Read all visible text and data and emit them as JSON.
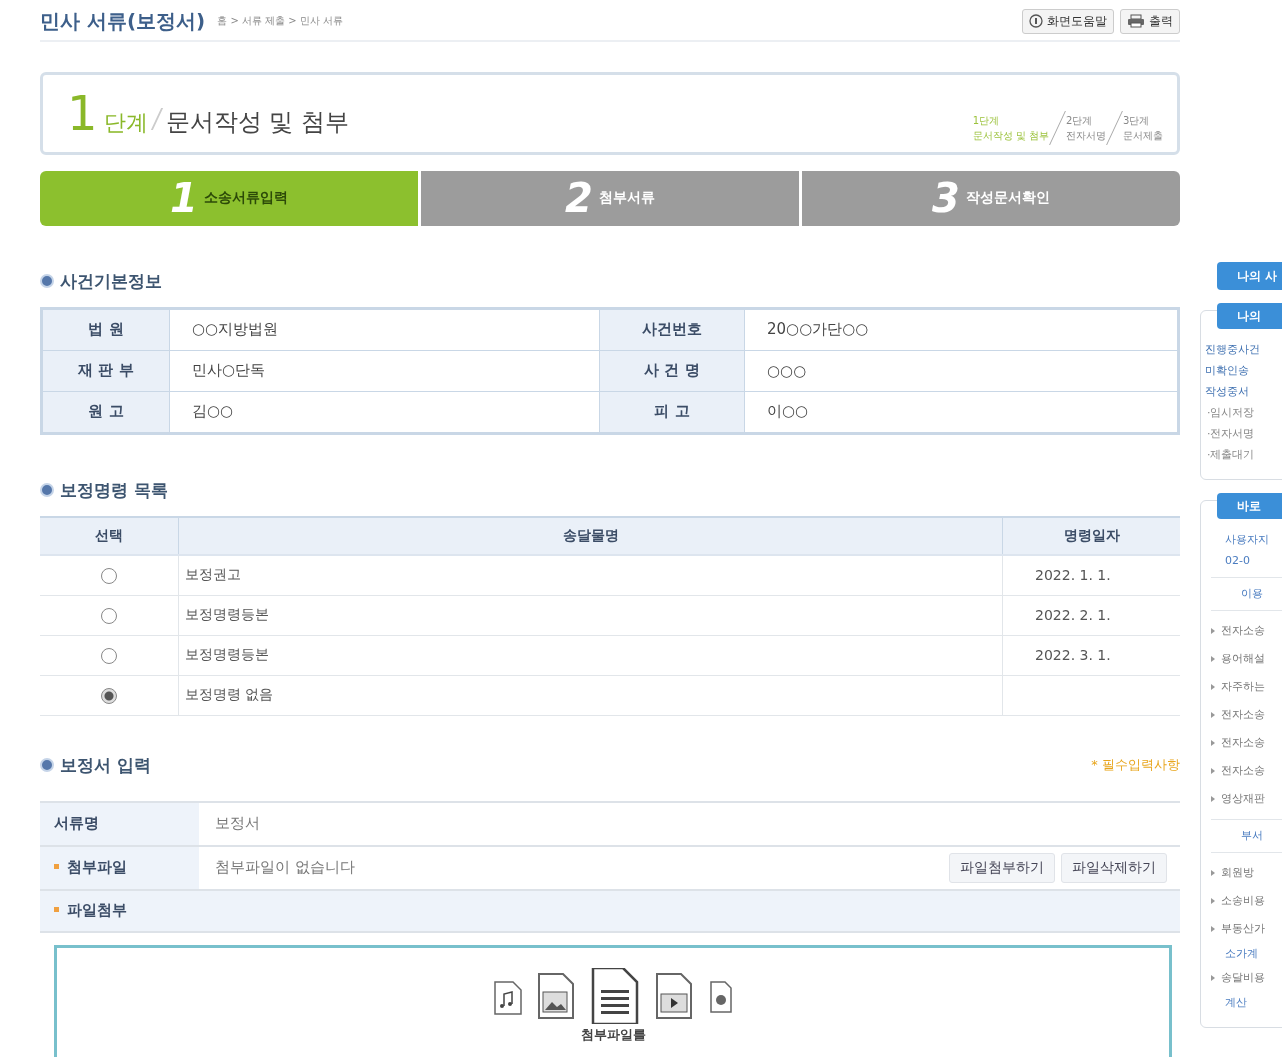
{
  "header": {
    "title": "민사 서류(보정서)",
    "breadcrumb": "홈 > 서류 제출 > 민사 서류",
    "buttons": [
      {
        "label": "화면도움말"
      },
      {
        "label": "출력"
      }
    ]
  },
  "step_banner": {
    "number": "1",
    "unit": "단계",
    "title": "문서작성 및 첨부",
    "steps": [
      {
        "label": "1단계",
        "desc": "문서작성 및 첨부",
        "selected": true
      },
      {
        "label": "2단계",
        "desc": "전자서명",
        "selected": false
      },
      {
        "label": "3단계",
        "desc": "문서제출",
        "selected": false
      }
    ]
  },
  "tabs": [
    {
      "number": "1",
      "label": "소송서류입력",
      "selected": true
    },
    {
      "number": "2",
      "label": "첨부서류",
      "selected": false
    },
    {
      "number": "3",
      "label": "작성문서확인",
      "selected": false
    }
  ],
  "case_info": {
    "title": "사건기본정보",
    "rows": [
      [
        {
          "label": "법 원",
          "value": "○○지방법원"
        },
        {
          "label": "사건번호",
          "value": "20○○가단○○"
        }
      ],
      [
        {
          "label": "재 판 부",
          "value": "민사○단독"
        },
        {
          "label": "사 건 명",
          "value": "○○○"
        }
      ],
      [
        {
          "label": "원 고",
          "value": "김○○"
        },
        {
          "label": "피 고",
          "value": "이○○"
        }
      ]
    ]
  },
  "orders": {
    "title": "보정명령 목록",
    "columns": [
      "선택",
      "송달물명",
      "명령일자"
    ],
    "rows": [
      {
        "name": "보정권고",
        "date": "2022. 1. 1.",
        "selected": false
      },
      {
        "name": "보정명령등본",
        "date": "2022. 2. 1.",
        "selected": false
      },
      {
        "name": "보정명령등본",
        "date": "2022. 3. 1.",
        "selected": false
      },
      {
        "name": "보정명령 없음",
        "date": "",
        "selected": true
      }
    ]
  },
  "form": {
    "title": "보정서 입력",
    "required_note": "* 필수입력사항",
    "doc_label": "서류명",
    "doc_value": "보정서",
    "file_label": "첨부파일",
    "file_value": "첨부파일이 없습니다",
    "file_buttons": [
      "파일첨부하기",
      "파일삭제하기"
    ],
    "attach_label": "파일첨부",
    "drop_label": "첨부파일를"
  },
  "sidebar": {
    "top_button": "나의 사",
    "panels": [
      {
        "title": "나의",
        "items": [
          {
            "kind": "link",
            "text": "진행중사건"
          },
          {
            "kind": "link",
            "text": "미확인송"
          },
          {
            "kind": "link",
            "text": "작성중서"
          },
          {
            "kind": "sub",
            "text": "·임시저장"
          },
          {
            "kind": "sub",
            "text": "·전자서명"
          },
          {
            "kind": "sub",
            "text": "·제출대기"
          }
        ]
      },
      {
        "title": "바로",
        "items": [
          {
            "kind": "text",
            "text": "사용자지"
          },
          {
            "kind": "text",
            "text": "02-0"
          },
          {
            "kind": "heading",
            "text": "이용"
          },
          {
            "kind": "bullet",
            "text": "전자소송"
          },
          {
            "kind": "bullet",
            "text": "용어해설"
          },
          {
            "kind": "bullet",
            "text": "자주하는"
          },
          {
            "kind": "bullet",
            "text": "전자소송"
          },
          {
            "kind": "bullet",
            "text": "전자소송"
          },
          {
            "kind": "bullet",
            "text": "전자소송"
          },
          {
            "kind": "bullet",
            "text": "영상재판"
          },
          {
            "kind": "heading",
            "text": "부서"
          },
          {
            "kind": "bullet",
            "text": "회원방"
          },
          {
            "kind": "bullet",
            "text": "소송비용"
          },
          {
            "kind": "bullet",
            "text": "부동산가"
          },
          {
            "kind": "text",
            "text": "소가계"
          },
          {
            "kind": "bullet",
            "text": "송달비용"
          },
          {
            "kind": "text",
            "text": "계산"
          }
        ]
      }
    ]
  }
}
